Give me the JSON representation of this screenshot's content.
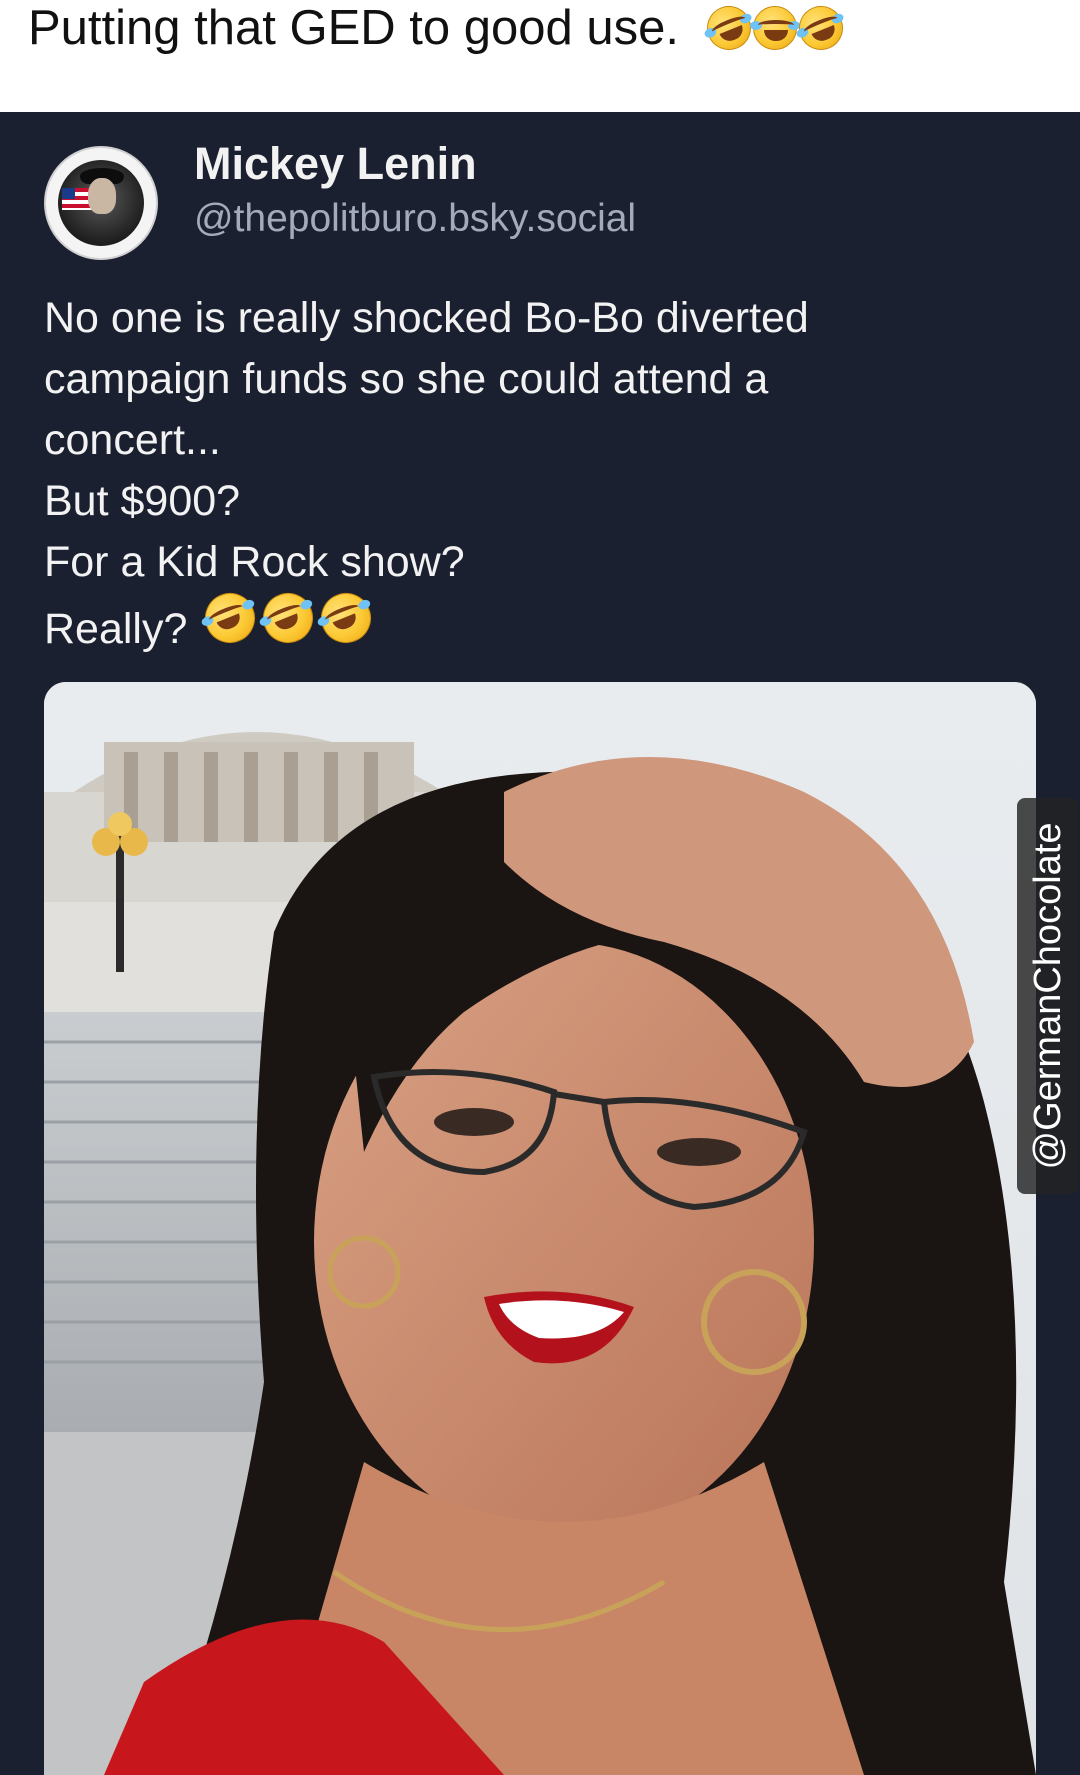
{
  "caption": {
    "text": "Putting that GED to good use.",
    "emoji": [
      "rolling-on-floor-laughing",
      "face-with-tears-of-joy",
      "rolling-on-floor-laughing"
    ]
  },
  "post": {
    "author": {
      "display_name": "Mickey Lenin",
      "handle": "@thepolitburo.bsky.social"
    },
    "body_lines": [
      "No one is really shocked Bo-Bo diverted",
      "campaign funds so she could attend a",
      "concert...",
      "But $900?",
      "For a Kid Rock show?",
      "Really?"
    ],
    "body_emoji": [
      "rolling-on-floor-laughing",
      "rolling-on-floor-laughing",
      "rolling-on-floor-laughing"
    ],
    "colors": {
      "background": "#1b2030",
      "text": "#f2f2f2",
      "handle": "#a3abba"
    }
  },
  "watermark": {
    "text": "@GermanChocolate"
  }
}
